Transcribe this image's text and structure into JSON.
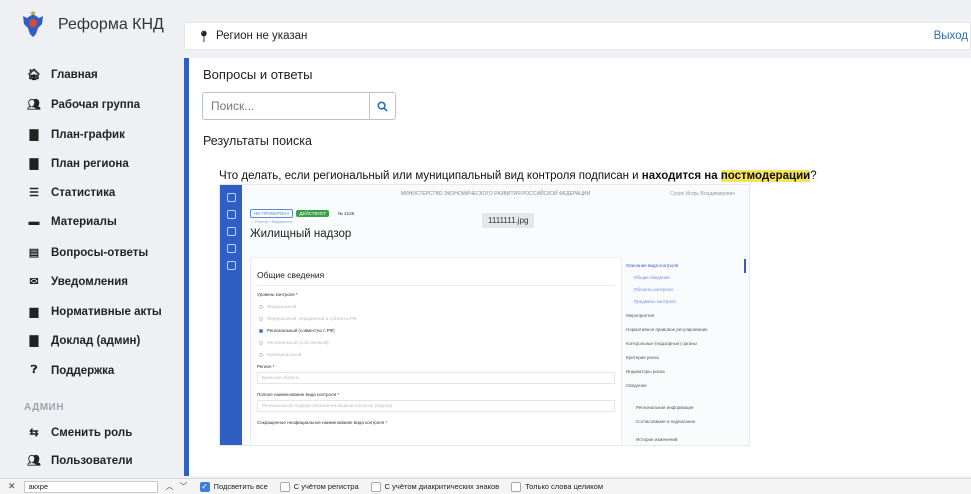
{
  "app": {
    "name": "Реформа КНД"
  },
  "topbar": {
    "region": "Регион не указан",
    "logout": "Выход"
  },
  "sidebar": {
    "items": [
      {
        "label": "Главная",
        "icon": "home-icon"
      },
      {
        "label": "Рабочая группа",
        "icon": "users-icon"
      },
      {
        "label": "План-график",
        "icon": "file-icon"
      },
      {
        "label": "План региона",
        "icon": "file-icon"
      },
      {
        "label": "Статистика",
        "icon": "list-icon"
      },
      {
        "label": "Материалы",
        "icon": "folder-icon"
      },
      {
        "label": "Вопросы-ответы",
        "icon": "comment-icon"
      },
      {
        "label": "Уведомления",
        "icon": "envelope-icon"
      },
      {
        "label": "Нормативные акты",
        "icon": "book-icon"
      },
      {
        "label": "Доклад (админ)",
        "icon": "file-icon"
      },
      {
        "label": "Поддержка",
        "icon": "question-icon"
      }
    ],
    "admin_section": "АДМИН",
    "admin_items": [
      {
        "label": "Сменить роль",
        "icon": "swap-icon"
      },
      {
        "label": "Пользователи",
        "icon": "users-icon"
      }
    ]
  },
  "main": {
    "title": "Вопросы и ответы",
    "search_placeholder": "Поиск...",
    "results_title": "Результаты поиска",
    "question": {
      "part1": "Что делать, если региональный или муниципальный вид контроля подписан и ",
      "bold": "находится на",
      "highlight": "постмодерации",
      "end": "?"
    }
  },
  "screenshot": {
    "header": "МИНИСТЕРСТВО ЭКОНОМИЧЕСКОГО РАЗВИТИЯ РОССИЙСКОЙ ФЕДЕРАЦИИ",
    "user": "Сухих Игорь Владимирович",
    "tag1": "НЕ ПРОВЕРЕНА",
    "tag2": "ДЕЙСТВУЕТ",
    "number": "№ 2128",
    "crumb": "← Реестр / Ведомости",
    "filename": "1111111.jpg",
    "title": "Жилищный надзор",
    "section": "Общие сведения",
    "level_label": "Уровень контроля *",
    "options": [
      "Федеральный",
      "Федеральный, переданный в субъекты РФ",
      "Региональный (совместно с РФ)",
      "Региональный (собственный)",
      "Муниципальный"
    ],
    "selected_option_index": 2,
    "region_label": "Регион *",
    "region_value": "Брянская область",
    "fullname_label": "Полное наименование вида контроля *",
    "fullname_value": "Региональный государственный жилищный контроль (надзор)",
    "shortname_label": "Сокращенное неофициальное наименование вида контроля *",
    "toc": [
      "Описание вида контроля",
      "Общие сведения",
      "Объекты контроля",
      "Предметы контроля",
      "Мероприятия",
      "Нормативное правовое регулирование",
      "Контрольные (надзорные) органы",
      "Критерии риска",
      "Индикаторы риска",
      "Сведения",
      "Региональная информация",
      "Согласование и подписание",
      "История изменений"
    ]
  },
  "findbar": {
    "query": "акхре",
    "options": [
      {
        "label": "Подсветить все",
        "checked": true
      },
      {
        "label": "С учётом регистра",
        "checked": false
      },
      {
        "label": "С учётом диакритических знаков",
        "checked": false
      },
      {
        "label": "Только слова целиком",
        "checked": false
      }
    ]
  },
  "colors": {
    "accent": "#2f5fc4",
    "link": "#2d6fb7",
    "highlight": "#f5e45c"
  }
}
